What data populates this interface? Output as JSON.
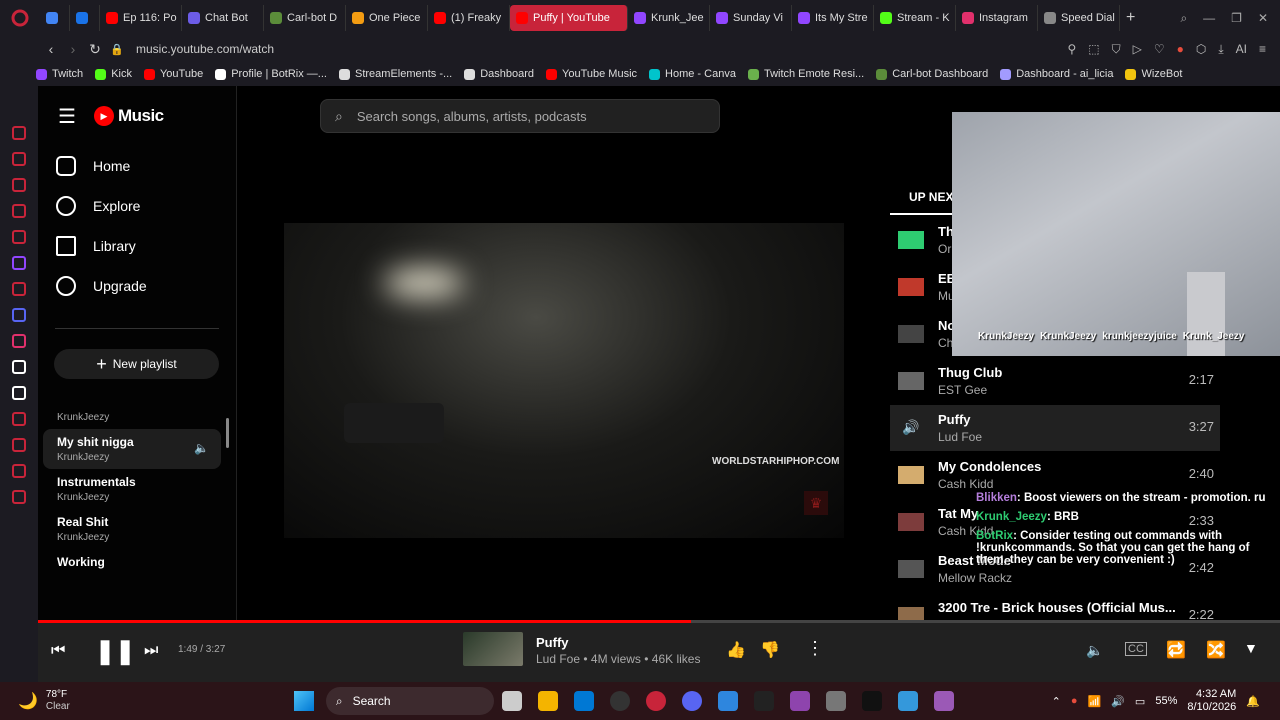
{
  "tabs": [
    {
      "label": "",
      "color": "#4285f4"
    },
    {
      "label": "",
      "color": "#1a73e8"
    },
    {
      "label": "Ep 116: Po",
      "color": "#ff0000"
    },
    {
      "label": "Chat Bot",
      "color": "#6c5ce7"
    },
    {
      "label": "Carl-bot D",
      "color": "#5b8c3a"
    },
    {
      "label": "One Piece",
      "color": "#f39c12"
    },
    {
      "label": "(1) Freaky",
      "color": "#ff0000"
    },
    {
      "label": "Puffy | YouTube",
      "color": "#ff0000",
      "active": true
    },
    {
      "label": "Krunk_Jee",
      "color": "#9146ff"
    },
    {
      "label": "Sunday Vi",
      "color": "#9146ff"
    },
    {
      "label": "Its My Stre",
      "color": "#9146ff"
    },
    {
      "label": "Stream - K",
      "color": "#53fc18"
    },
    {
      "label": "Instagram",
      "color": "#e1306c"
    },
    {
      "label": "Speed Dial",
      "color": "#888888"
    }
  ],
  "address": {
    "url": "music.youtube.com/watch"
  },
  "bookmarks": [
    {
      "label": "Twitch",
      "color": "#9146ff"
    },
    {
      "label": "Kick",
      "color": "#53fc18"
    },
    {
      "label": "YouTube",
      "color": "#ff0000"
    },
    {
      "label": "Profile | BotRix —...",
      "color": "#ffffff"
    },
    {
      "label": "StreamElements -...",
      "color": "#dddddd"
    },
    {
      "label": "Dashboard",
      "color": "#dddddd"
    },
    {
      "label": "YouTube Music",
      "color": "#ff0000"
    },
    {
      "label": "Home - Canva",
      "color": "#00c4cc"
    },
    {
      "label": "Twitch Emote Resi...",
      "color": "#6ab04c"
    },
    {
      "label": "Carl-bot Dashboard",
      "color": "#5b8c3a"
    },
    {
      "label": "Dashboard - ai_licia",
      "color": "#a29bfe"
    },
    {
      "label": "WizeBot",
      "color": "#f1c40f"
    }
  ],
  "yt": {
    "logo": "Music",
    "search_placeholder": "Search songs, albums, artists, podcasts",
    "nav": [
      "Home",
      "Explore",
      "Library",
      "Upgrade"
    ],
    "new_playlist": "New playlist",
    "playlists": [
      {
        "title": "",
        "subtitle": "KrunkJeezy"
      },
      {
        "title": "My shit nigga",
        "subtitle": "KrunkJeezy",
        "playing": true
      },
      {
        "title": "Instrumentals",
        "subtitle": "KrunkJeezy"
      },
      {
        "title": "Real Shit",
        "subtitle": "KrunkJeezy"
      },
      {
        "title": "Working",
        "subtitle": ""
      }
    ]
  },
  "video": {
    "watermark": "WORLDSTARHIPHOP.COM"
  },
  "upnext": {
    "label": "UP NEXT",
    "items": [
      {
        "title": "Th",
        "artist": "Or",
        "duration": "",
        "thumb": "#2ecc71"
      },
      {
        "title": "EB",
        "artist": "Mu",
        "duration": "",
        "thumb": "#c0392b"
      },
      {
        "title": "No",
        "artist": "Ch",
        "duration": "",
        "thumb": "#444444"
      },
      {
        "title": "Thug Club",
        "artist": "EST Gee",
        "duration": "2:17",
        "thumb": "#666666"
      },
      {
        "title": "Puffy",
        "artist": "Lud Foe",
        "duration": "3:27",
        "thumb": "",
        "playing": true
      },
      {
        "title": "My Condolences",
        "artist": "Cash Kidd",
        "duration": "2:40",
        "thumb": "#d4ac6e"
      },
      {
        "title": "Tat My",
        "artist": "Cash Kidd",
        "duration": "2:33",
        "thumb": "#7d3c3c"
      },
      {
        "title": "Beast Mode",
        "artist": "Mellow Rackz",
        "duration": "2:42",
        "thumb": "#555555"
      },
      {
        "title": "3200 Tre - Brick houses (Official Mus...",
        "artist": "3200 TRE",
        "duration": "2:22",
        "thumb": "#8e6b4a"
      }
    ]
  },
  "overlay": {
    "socials": [
      "KrunkJeezy",
      "KrunkJeezy",
      "krunkjeezyjuice",
      "Krunk_Jeezy"
    ],
    "chat": [
      {
        "user": "Blikken",
        "text": ": Boost viewers on the stream - promotion. ru",
        "color": "#b57edc"
      },
      {
        "user": "Krunk_Jeezy",
        "text": ": BRB",
        "color": "#2ecc71"
      },
      {
        "user": "BotRix",
        "text": ": Consider testing out commands with !krunkcommands. So that you can get the hang of them, they can be very convenient :)",
        "color": "#2ecc71"
      }
    ]
  },
  "player": {
    "time": "1:49 / 3:27",
    "progress": 0.526,
    "title": "Puffy",
    "meta": "Lud Foe • 4M views • 46K likes"
  },
  "taskbar": {
    "weather_temp": "78°F",
    "weather_desc": "Clear",
    "search": "Search",
    "battery": "55%",
    "time": "4:32 AM",
    "date": "8/10/2026"
  }
}
